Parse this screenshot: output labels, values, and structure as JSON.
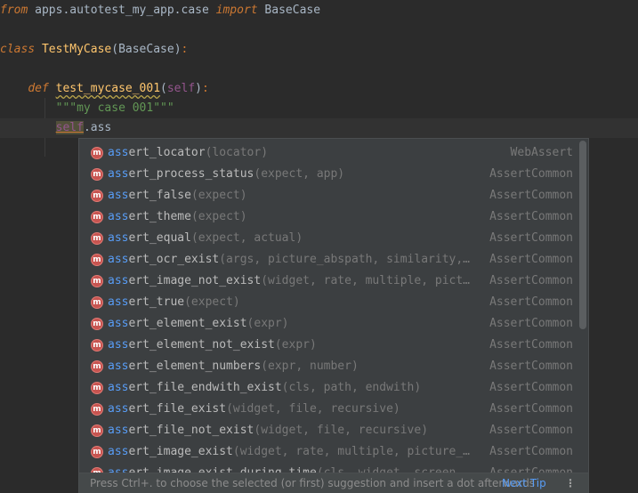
{
  "editor": {
    "line1": {
      "kw": "from",
      "mid": " apps.autotest_my_app.case ",
      "kw2": "import",
      "end": " BaseCase"
    },
    "line2": {
      "kw": "class",
      "name": "TestMyCase",
      "open": "(",
      "base": "BaseCase",
      "close": ")",
      "colon": ":"
    },
    "line3": {
      "kw": "def",
      "name": "test_mycase_001",
      "open": "(",
      "self": "self",
      "close": ")",
      "colon": ":"
    },
    "line4": {
      "doc": "\"\"\"my case 001\"\"\""
    },
    "line5": {
      "self": "self",
      "dot": ".",
      "typed": "ass"
    }
  },
  "completion": {
    "icon_letter": "m",
    "items": [
      {
        "match": "ass",
        "rest": "ert_locator",
        "params": "(locator)",
        "type": "WebAssert"
      },
      {
        "match": "ass",
        "rest": "ert_process_status",
        "params": "(expect, app)",
        "type": "AssertCommon"
      },
      {
        "match": "ass",
        "rest": "ert_false",
        "params": "(expect)",
        "type": "AssertCommon"
      },
      {
        "match": "ass",
        "rest": "ert_theme",
        "params": "(expect)",
        "type": "AssertCommon"
      },
      {
        "match": "ass",
        "rest": "ert_equal",
        "params": "(expect, actual)",
        "type": "AssertCommon"
      },
      {
        "match": "ass",
        "rest": "ert_ocr_exist",
        "params": "(args, picture_abspath, similarity,…",
        "type": "AssertCommon"
      },
      {
        "match": "ass",
        "rest": "ert_image_not_exist",
        "params": "(widget, rate, multiple, pict…",
        "type": "AssertCommon"
      },
      {
        "match": "ass",
        "rest": "ert_true",
        "params": "(expect)",
        "type": "AssertCommon"
      },
      {
        "match": "ass",
        "rest": "ert_element_exist",
        "params": "(expr)",
        "type": "AssertCommon"
      },
      {
        "match": "ass",
        "rest": "ert_element_not_exist",
        "params": "(expr)",
        "type": "AssertCommon"
      },
      {
        "match": "ass",
        "rest": "ert_element_numbers",
        "params": "(expr, number)",
        "type": "AssertCommon"
      },
      {
        "match": "ass",
        "rest": "ert_file_endwith_exist",
        "params": "(cls, path, endwith)",
        "type": "AssertCommon"
      },
      {
        "match": "ass",
        "rest": "ert_file_exist",
        "params": "(widget, file, recursive)",
        "type": "AssertCommon"
      },
      {
        "match": "ass",
        "rest": "ert_file_not_exist",
        "params": "(widget, file, recursive)",
        "type": "AssertCommon"
      },
      {
        "match": "ass",
        "rest": "ert_image_exist",
        "params": "(widget, rate, multiple, picture_…",
        "type": "AssertCommon"
      },
      {
        "match": "ass",
        "rest": "ert_image_exist_during_time",
        "params": "(cls, widget, screen_…",
        "type": "AssertCommon"
      }
    ],
    "footer_hint": "Press Ctrl+. to choose the selected (or first) suggestion and insert a dot afterwards",
    "next_tip": "Next Tip",
    "more_label": "⋮"
  },
  "colors": {
    "background": "#2b2b2b",
    "keyword": "#cc7832",
    "function": "#ffc66d",
    "self": "#94558d",
    "docstring": "#629755",
    "match": "#589df6",
    "method_icon": "#c75450"
  }
}
